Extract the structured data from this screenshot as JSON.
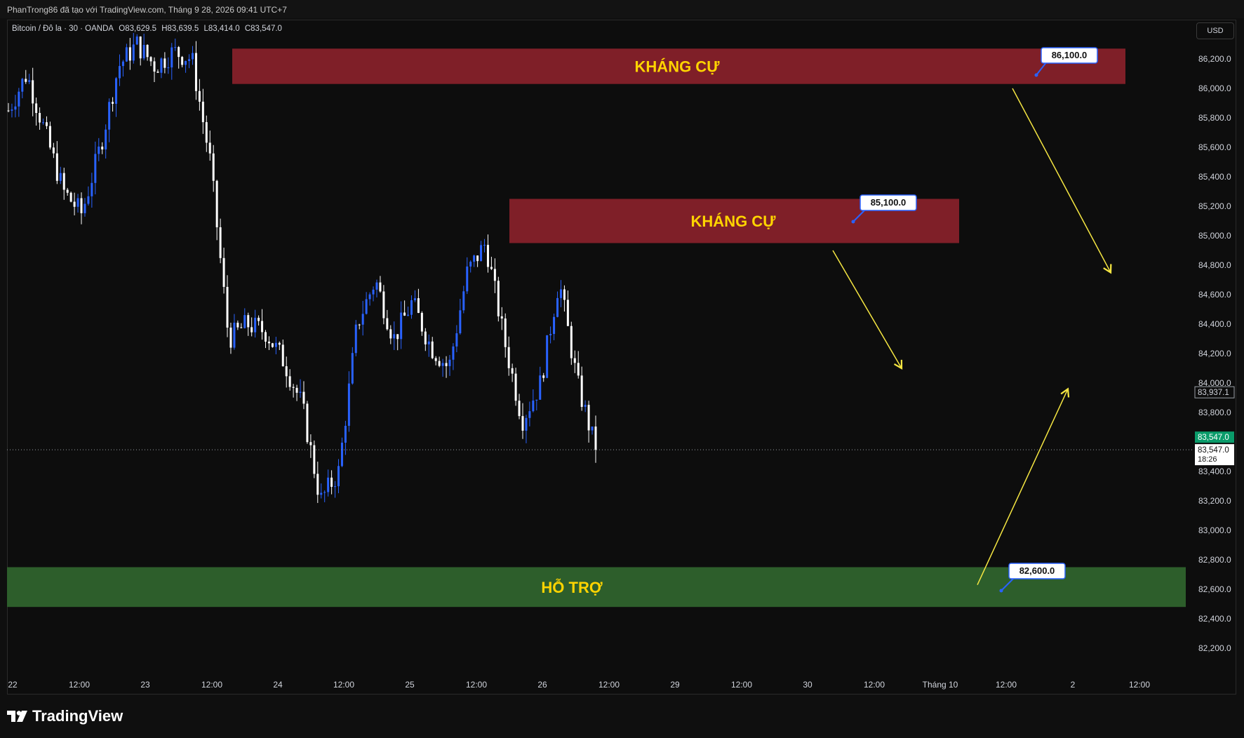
{
  "header": {
    "author_line": "PhanTrong86 đã tạo với TradingView.com, Tháng 9 28, 2026 09:41 UTC+7"
  },
  "legend": {
    "symbol": "Bitcoin / Đô la · 30 · OANDA",
    "open": "O83,629.5",
    "high": "H83,639.5",
    "low": "L83,414.0",
    "close": "C83,547.0"
  },
  "currency": "USD",
  "brand": {
    "name": "TradingView"
  },
  "colors": {
    "background": "#0d0d0d",
    "up_candle": "#2962ff",
    "down_candle": "#ffffff",
    "resistance_zone": "#7f1f28",
    "support_zone": "#2d5e2b",
    "zone_text": "#ffd400",
    "arrow": "#f5e642",
    "price_tag_last": "#0a9b6a"
  },
  "chart_data": {
    "type": "candlestick",
    "symbol": "Bitcoin / Đô la",
    "timeframe": "30",
    "exchange": "OANDA",
    "y_ticks": [
      86200,
      86000,
      85800,
      85600,
      85400,
      85200,
      85000,
      84800,
      84600,
      84400,
      84200,
      84000,
      83800,
      83400,
      83200,
      83000,
      82800,
      82600,
      82400,
      82200
    ],
    "y_tick_labels": [
      "86,200.0",
      "86,000.0",
      "85,800.0",
      "85,600.0",
      "85,400.0",
      "85,200.0",
      "85,000.0",
      "84,800.0",
      "84,600.0",
      "84,400.0",
      "84,200.0",
      "84,000.0",
      "83,800.0",
      "83,400.0",
      "83,200.0",
      "83,000.0",
      "82,800.0",
      "82,600.0",
      "82,400.0",
      "82,200.0"
    ],
    "ylim": [
      82000,
      86400
    ],
    "x_ticks": [
      "22",
      "12:00",
      "23",
      "12:00",
      "24",
      "12:00",
      "25",
      "12:00",
      "26",
      "12:00",
      "29",
      "12:00",
      "30",
      "12:00",
      "Tháng 10",
      "12:00",
      "2",
      "12:00"
    ],
    "last_price": 83547.0,
    "last_price_label": "83,547.0",
    "last_price_sub_label": "83,547.0",
    "countdown": "18:26",
    "marker_price_label": "83,937.1",
    "price_path": [
      [
        0,
        85850
      ],
      [
        1,
        86100
      ],
      [
        2,
        85700
      ],
      [
        3,
        85300
      ],
      [
        4,
        85150
      ],
      [
        5,
        85600
      ],
      [
        6,
        86150
      ],
      [
        7,
        86300
      ],
      [
        8,
        86150
      ],
      [
        9,
        86250
      ],
      [
        10,
        86200
      ],
      [
        11,
        85500
      ],
      [
        12,
        84300
      ],
      [
        13,
        84400
      ],
      [
        14,
        84350
      ],
      [
        15,
        84150
      ],
      [
        16,
        83850
      ],
      [
        17,
        83200
      ],
      [
        18,
        83400
      ],
      [
        19,
        84400
      ],
      [
        20,
        84700
      ],
      [
        21,
        84300
      ],
      [
        22,
        84550
      ],
      [
        23,
        84250
      ],
      [
        24,
        84100
      ],
      [
        25,
        84750
      ],
      [
        26,
        84950
      ],
      [
        27,
        84300
      ],
      [
        28,
        83750
      ],
      [
        29,
        84000
      ],
      [
        30,
        84700
      ],
      [
        31,
        84000
      ],
      [
        32,
        83547
      ]
    ],
    "zones": [
      {
        "type": "resistance",
        "label": "KHÁNG CỰ",
        "from": 86030,
        "to": 86270,
        "price_label": "86,100.0"
      },
      {
        "type": "resistance",
        "label": "KHÁNG CỰ",
        "from": 84950,
        "to": 85250,
        "price_label": "85,100.0"
      },
      {
        "type": "support",
        "label": "HỖ TRỢ",
        "from": 82480,
        "to": 82750,
        "price_label": "82,600.0"
      }
    ],
    "arrows": [
      {
        "from_price": 86000,
        "to_price": 84750,
        "direction": "down"
      },
      {
        "from_price": 84900,
        "to_price": 84100,
        "direction": "down"
      },
      {
        "from_price": 82630,
        "to_price": 83960,
        "direction": "up"
      }
    ],
    "grid": false
  }
}
